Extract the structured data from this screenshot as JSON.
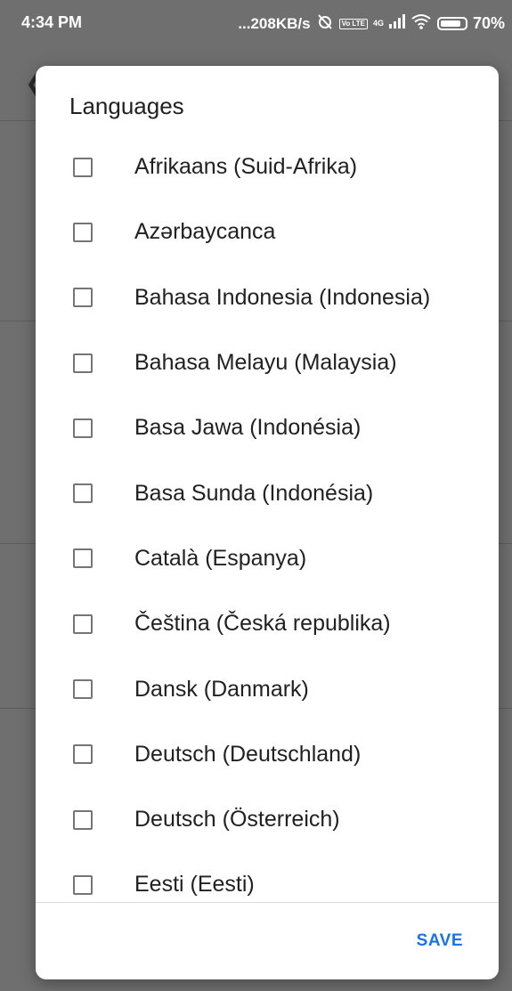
{
  "status_bar": {
    "time": "4:34 PM",
    "net_speed": "...208KB/s",
    "battery": "70%",
    "volte": "Vo LTE",
    "network": "4G"
  },
  "dialog": {
    "title": "Languages",
    "items": [
      {
        "label": "Afrikaans (Suid-Afrika)",
        "checked": false
      },
      {
        "label": "Azərbaycanca",
        "checked": false
      },
      {
        "label": "Bahasa Indonesia (Indonesia)",
        "checked": false
      },
      {
        "label": "Bahasa Melayu (Malaysia)",
        "checked": false
      },
      {
        "label": "Basa Jawa (Indonésia)",
        "checked": false
      },
      {
        "label": "Basa Sunda (Indonésia)",
        "checked": false
      },
      {
        "label": "Català (Espanya)",
        "checked": false
      },
      {
        "label": "Čeština (Česká republika)",
        "checked": false
      },
      {
        "label": "Dansk (Danmark)",
        "checked": false
      },
      {
        "label": "Deutsch (Deutschland)",
        "checked": false
      },
      {
        "label": "Deutsch (Österreich)",
        "checked": false
      },
      {
        "label": "Eesti (Eesti)",
        "checked": false
      }
    ],
    "save_label": "SAVE"
  },
  "colors": {
    "accent": "#1a73e8",
    "scrim": "#6f6f6f"
  }
}
